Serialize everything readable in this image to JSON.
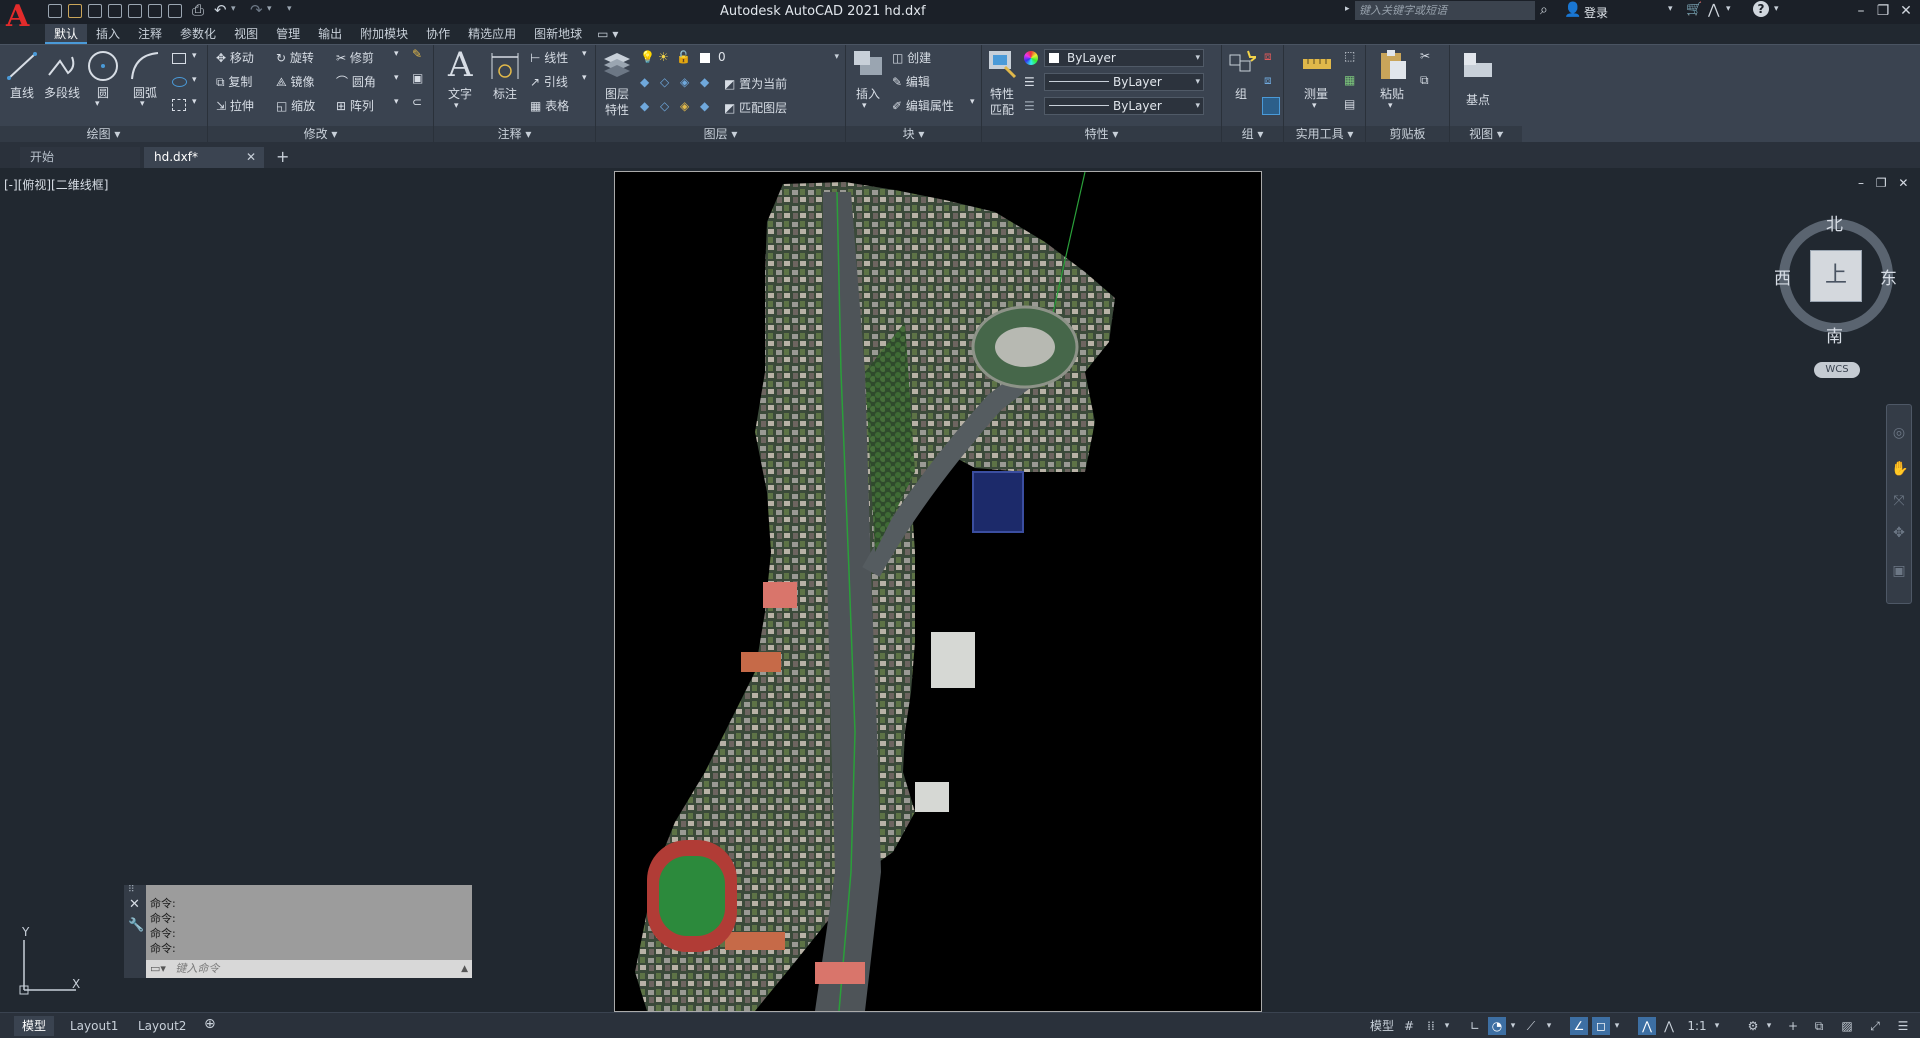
{
  "title_bar": {
    "window_title": "Autodesk AutoCAD 2021    hd.dxf",
    "search_placeholder": "键入关键字或短语",
    "sign_in": "登录",
    "accent_color": "#e32b2b"
  },
  "menu_tabs": [
    "默认",
    "插入",
    "注释",
    "参数化",
    "视图",
    "管理",
    "输出",
    "附加模块",
    "协作",
    "精选应用",
    "图新地球"
  ],
  "ribbon": {
    "draw": {
      "title": "绘图 ▾",
      "line": "直线",
      "polyline": "多段线",
      "circle": "圆",
      "arc": "圆弧"
    },
    "modify": {
      "title": "修改 ▾",
      "move": "移动",
      "rotate": "旋转",
      "trim": "修剪",
      "copy": "复制",
      "mirror": "镜像",
      "fillet": "圆角",
      "stretch": "拉伸",
      "scale": "缩放",
      "array": "阵列"
    },
    "annotation": {
      "title": "注释 ▾",
      "text": "文字",
      "dimension": "标注",
      "linear": "线性",
      "leader": "引线",
      "table": "表格"
    },
    "layers": {
      "title": "图层 ▾",
      "layer_props_1": "图层",
      "layer_props_2": "特性",
      "current_layer": "0",
      "set_current": "置为当前",
      "match_layer": "匹配图层"
    },
    "block": {
      "title": "块 ▾",
      "insert": "插入",
      "create": "创建",
      "edit": "编辑",
      "edit_attributes": "编辑属性"
    },
    "properties": {
      "title": "特性 ▾",
      "match_1": "特性",
      "match_2": "匹配",
      "color": "ByLayer",
      "linetype": "ByLayer",
      "lineweight": "ByLayer"
    },
    "groups": {
      "title": "组 ▾",
      "group": "组"
    },
    "utilities": {
      "title": "实用工具 ▾",
      "measure": "测量"
    },
    "clipboard": {
      "title": "剪贴板",
      "paste": "粘贴"
    },
    "view": {
      "title": "视图 ▾",
      "base": "基点"
    }
  },
  "doc_tabs": {
    "start": "开始",
    "active": "hd.dxf*",
    "close": "✕",
    "add": "+"
  },
  "viewport": {
    "label": "[-][俯视][二维线框]"
  },
  "viewcube": {
    "north": "北",
    "south": "南",
    "east": "东",
    "west": "西",
    "top": "上",
    "wcs": "WCS"
  },
  "ucs": {
    "x": "X",
    "y": "Y"
  },
  "command_window": {
    "history": [
      "命令:",
      "命令:",
      "命令:",
      "命令:"
    ],
    "input_placeholder": "键入命令"
  },
  "layout_tabs": [
    "模型",
    "Layout1",
    "Layout2"
  ],
  "status_bar": {
    "model": "模型",
    "scale": "1:1"
  }
}
